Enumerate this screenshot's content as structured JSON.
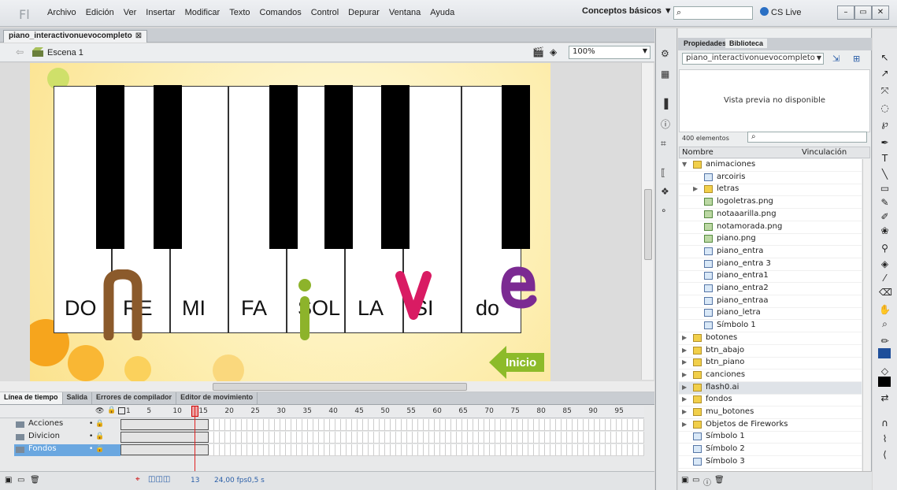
{
  "app": {
    "logo_text": "Fl",
    "menus": [
      "Archivo",
      "Edición",
      "Ver",
      "Insertar",
      "Modificar",
      "Texto",
      "Comandos",
      "Control",
      "Depurar",
      "Ventana",
      "Ayuda"
    ],
    "workspace": "Conceptos básicos ▼",
    "search_placeholder": "",
    "cslive": "CS Live"
  },
  "document": {
    "tab": "piano_interactivonuevocompleto",
    "scene": "Escena 1",
    "zoom": "100%"
  },
  "stage": {
    "notes": [
      "DO",
      "RE",
      "MI",
      "FA",
      "SOL",
      "LA",
      "SI",
      "do"
    ],
    "inicio_label": "Inicio"
  },
  "timeline": {
    "tabs": [
      "Línea de tiempo",
      "Salida",
      "Errores de compilador",
      "Editor de movimiento"
    ],
    "frame_numbers": [
      "1",
      "5",
      "10",
      "15",
      "20",
      "25",
      "30",
      "35",
      "40",
      "45",
      "50",
      "55",
      "60",
      "65",
      "70",
      "75",
      "80",
      "85",
      "90",
      "95"
    ],
    "layers": [
      {
        "name": "Acciones",
        "color": "#f47b20"
      },
      {
        "name": "Divicion",
        "color": "#8a2be2"
      },
      {
        "name": "Fondos",
        "color": "#2ecc40"
      }
    ],
    "current_frame": "13",
    "fps": "24,00 fps",
    "time": "0,5 s"
  },
  "library": {
    "tabs": [
      "Propiedades",
      "Biblioteca"
    ],
    "selected_doc": "piano_interactivonuevocompleto",
    "preview_text": "Vista previa no disponible",
    "count": "400 elementos",
    "col_name": "Nombre",
    "col_link": "Vinculación",
    "items": [
      {
        "name": "animaciones",
        "type": "folder",
        "indent": 0,
        "expanded": true
      },
      {
        "name": "arcoiris",
        "type": "sym",
        "indent": 1
      },
      {
        "name": "letras",
        "type": "folder",
        "indent": 1,
        "expanded": false
      },
      {
        "name": "logoletras.png",
        "type": "bmp",
        "indent": 1
      },
      {
        "name": "notaaarilla.png",
        "type": "bmp",
        "indent": 1
      },
      {
        "name": "notamorada.png",
        "type": "bmp",
        "indent": 1
      },
      {
        "name": "piano.png",
        "type": "bmp",
        "indent": 1
      },
      {
        "name": "piano_entra",
        "type": "sym",
        "indent": 1
      },
      {
        "name": "piano_entra 3",
        "type": "sym",
        "indent": 1
      },
      {
        "name": "piano_entra1",
        "type": "sym",
        "indent": 1
      },
      {
        "name": "piano_entra2",
        "type": "sym",
        "indent": 1
      },
      {
        "name": "piano_entraa",
        "type": "sym",
        "indent": 1
      },
      {
        "name": "piano_letra",
        "type": "sym",
        "indent": 1
      },
      {
        "name": "Símbolo 1",
        "type": "sym",
        "indent": 1
      },
      {
        "name": "botones",
        "type": "folder",
        "indent": 0
      },
      {
        "name": "btn_abajo",
        "type": "folder",
        "indent": 0
      },
      {
        "name": "btn_piano",
        "type": "folder",
        "indent": 0
      },
      {
        "name": "canciones",
        "type": "folder",
        "indent": 0
      },
      {
        "name": "flash0.ai",
        "type": "folder",
        "indent": 0
      },
      {
        "name": "fondos",
        "type": "folder",
        "indent": 0
      },
      {
        "name": "mu_botones",
        "type": "folder",
        "indent": 0
      },
      {
        "name": "Objetos de Fireworks",
        "type": "folder",
        "indent": 0
      },
      {
        "name": "Símbolo 1",
        "type": "sym",
        "indent": 0
      },
      {
        "name": "Símbolo 2",
        "type": "sym",
        "indent": 0
      },
      {
        "name": "Símbolo 3",
        "type": "sym",
        "indent": 0
      }
    ]
  }
}
